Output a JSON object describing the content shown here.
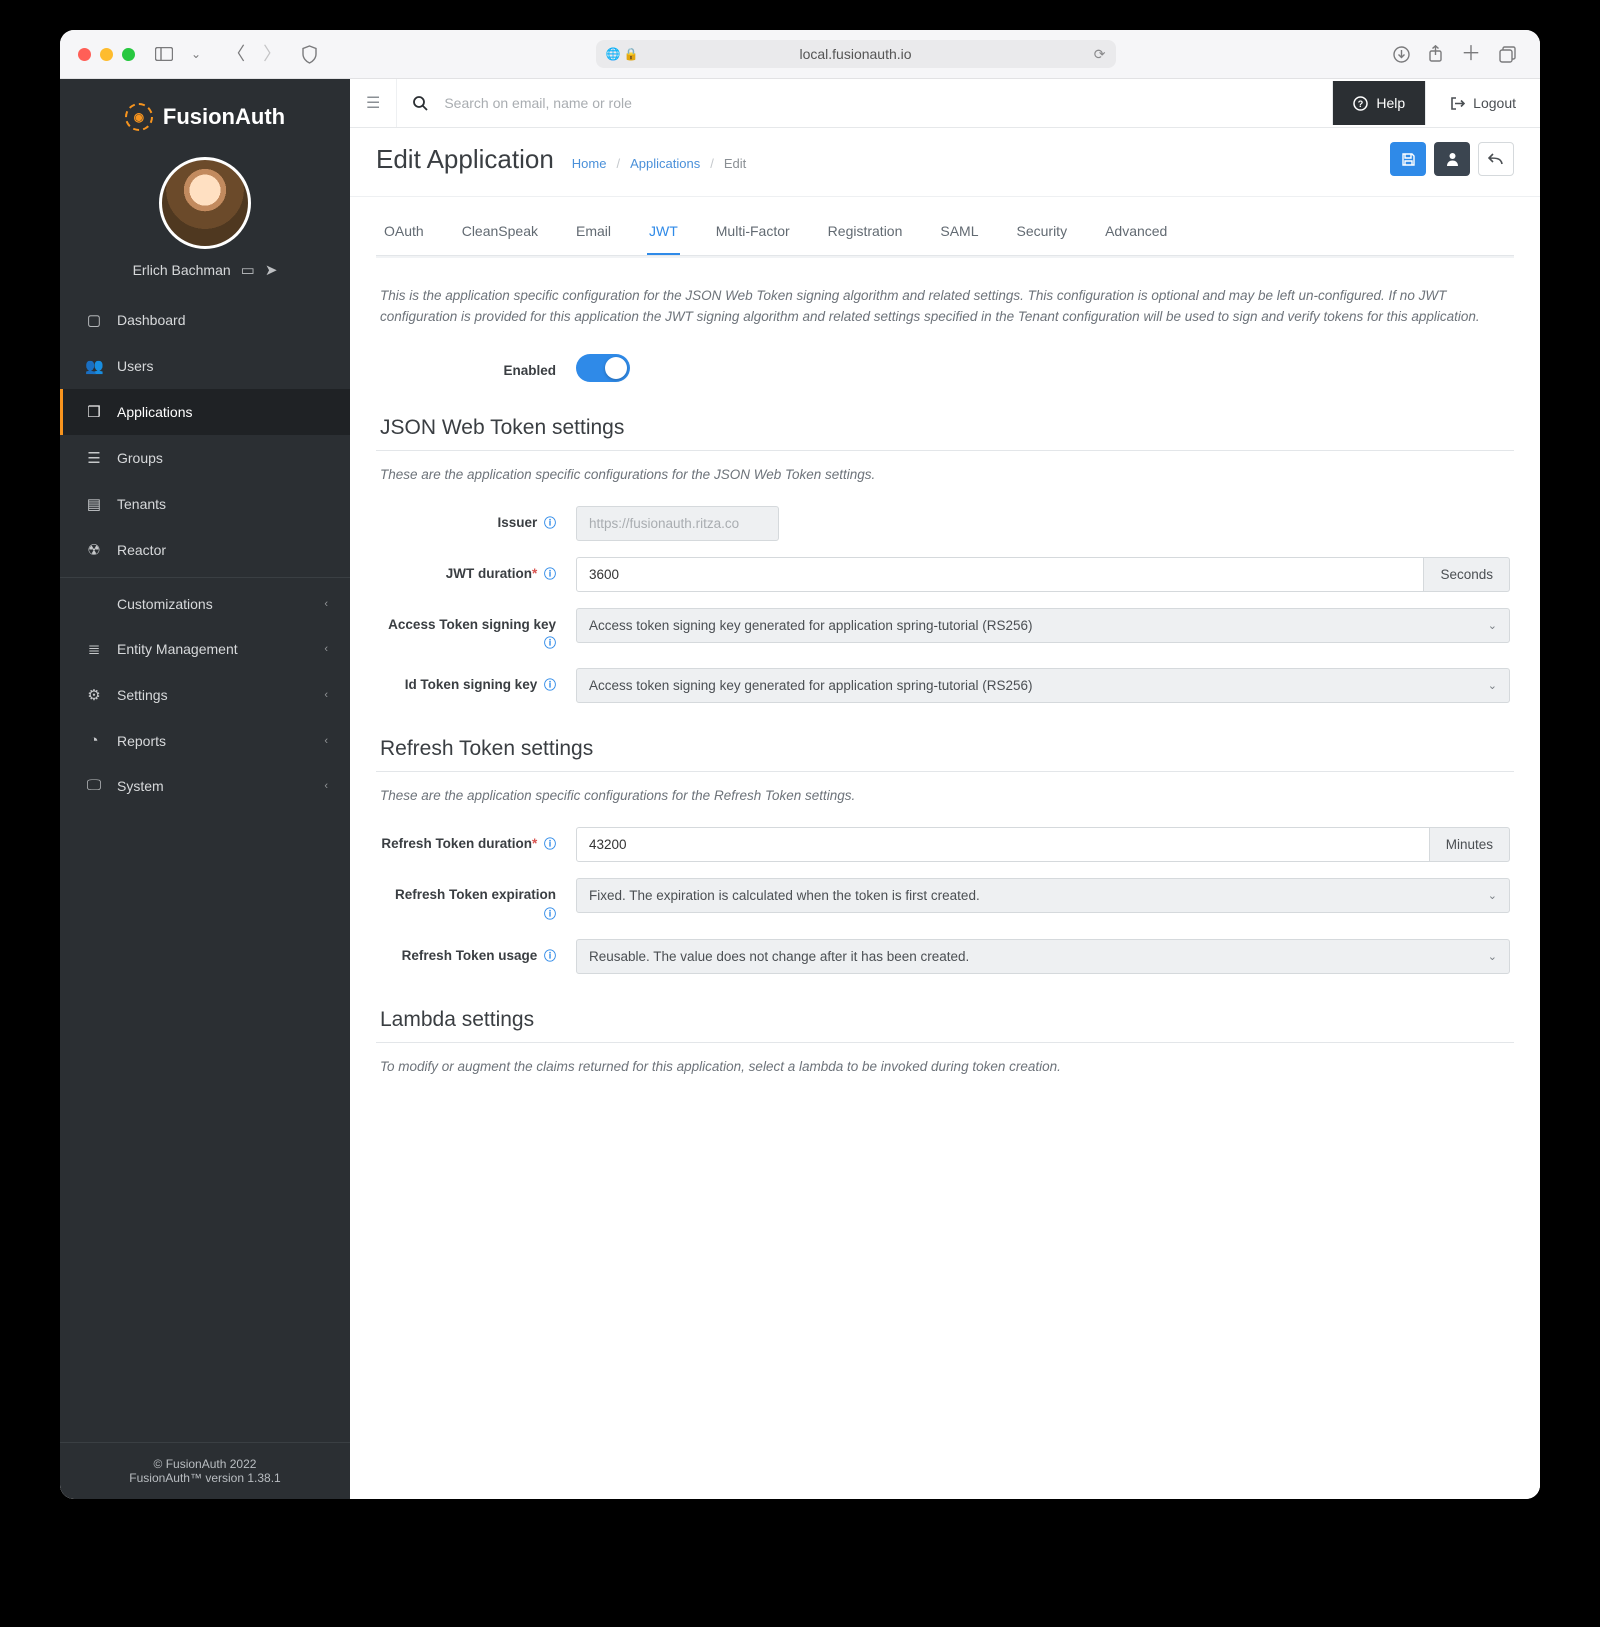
{
  "browser": {
    "url": "local.fusionauth.io"
  },
  "brand": "FusionAuth",
  "user": {
    "name": "Erlich Bachman"
  },
  "sidebar": {
    "items": [
      {
        "label": "Dashboard",
        "icon": "▢"
      },
      {
        "label": "Users",
        "icon": "👥"
      },
      {
        "label": "Applications",
        "icon": "❒",
        "active": true
      },
      {
        "label": "Groups",
        "icon": "☰"
      },
      {
        "label": "Tenants",
        "icon": "▤"
      },
      {
        "label": "Reactor",
        "icon": "☢"
      }
    ],
    "groups": [
      {
        "label": "Customizations",
        "icon": "</>"
      },
      {
        "label": "Entity Management",
        "icon": "≣"
      },
      {
        "label": "Settings",
        "icon": "⚙"
      },
      {
        "label": "Reports",
        "icon": "◔"
      },
      {
        "label": "System",
        "icon": "🖵"
      }
    ],
    "footer1": "© FusionAuth 2022",
    "footer2": "FusionAuth™ version 1.38.1"
  },
  "topbar": {
    "search_placeholder": "Search on email, name or role",
    "help": "Help",
    "logout": "Logout"
  },
  "page": {
    "title": "Edit Application",
    "crumbs": [
      "Home",
      "Applications",
      "Edit"
    ]
  },
  "tabs": [
    "OAuth",
    "CleanSpeak",
    "Email",
    "JWT",
    "Multi-Factor",
    "Registration",
    "SAML",
    "Security",
    "Advanced"
  ],
  "active_tab": "JWT",
  "jwt": {
    "intro": "This is the application specific configuration for the JSON Web Token signing algorithm and related settings. This configuration is optional and may be left un-configured. If no JWT configuration is provided for this application the JWT signing algorithm and related settings specified in the Tenant configuration will be used to sign and verify tokens for this application.",
    "enabled_label": "Enabled",
    "section1_title": "JSON Web Token settings",
    "section1_sub": "These are the application specific configurations for the JSON Web Token settings.",
    "issuer_label": "Issuer",
    "issuer_placeholder": "https://fusionauth.ritza.co",
    "duration_label": "JWT duration",
    "duration_value": "3600",
    "duration_unit": "Seconds",
    "access_key_label": "Access Token signing key",
    "access_key_value": "Access token signing key generated for application spring-tutorial (RS256)",
    "id_key_label": "Id Token signing key",
    "id_key_value": "Access token signing key generated for application spring-tutorial (RS256)",
    "section2_title": "Refresh Token settings",
    "section2_sub": "These are the application specific configurations for the Refresh Token settings.",
    "refresh_dur_label": "Refresh Token duration",
    "refresh_dur_value": "43200",
    "refresh_dur_unit": "Minutes",
    "refresh_exp_label": "Refresh Token expiration",
    "refresh_exp_value": "Fixed. The expiration is calculated when the token is first created.",
    "refresh_use_label": "Refresh Token usage",
    "refresh_use_value": "Reusable. The value does not change after it has been created.",
    "section3_title": "Lambda settings",
    "section3_sub": "To modify or augment the claims returned for this application, select a lambda to be invoked during token creation."
  }
}
